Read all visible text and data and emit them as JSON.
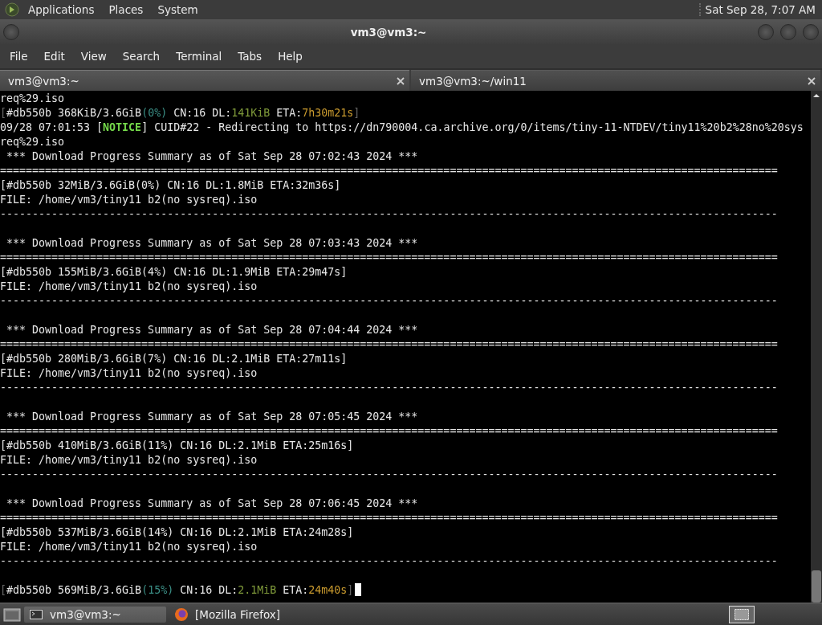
{
  "top_panel": {
    "menus": [
      "Applications",
      "Places",
      "System"
    ],
    "clock": "Sat Sep 28, 7:07 AM"
  },
  "window": {
    "title": "vm3@vm3:~"
  },
  "menu_bar": [
    "File",
    "Edit",
    "View",
    "Search",
    "Terminal",
    "Tabs",
    "Help"
  ],
  "tabs": [
    {
      "label": "vm3@vm3:~",
      "selected": true
    },
    {
      "label": "vm3@vm3:~/win11",
      "selected": false
    }
  ],
  "terminal": {
    "lines": [
      {
        "blank_before": false,
        "segments": [
          {
            "kind": "text",
            "text": "req%29.iso"
          }
        ]
      },
      {
        "blank_before": false,
        "segments": [
          {
            "kind": "dim",
            "text": "["
          },
          {
            "kind": "text",
            "text": "#db550b 368KiB/3.6GiB"
          },
          {
            "kind": "percent",
            "text": "(0%)"
          },
          {
            "kind": "text",
            "text": " CN:16 DL:"
          },
          {
            "kind": "speed",
            "text": "141KiB"
          },
          {
            "kind": "text",
            "text": " ETA:"
          },
          {
            "kind": "eta",
            "text": "7h30m21s"
          },
          {
            "kind": "dim",
            "text": "]"
          }
        ]
      },
      {
        "blank_before": false,
        "segments": [
          {
            "kind": "text",
            "text": "09/28 07:01:53 ["
          },
          {
            "kind": "notice",
            "text": "NOTICE"
          },
          {
            "kind": "text",
            "text": "] CUID#22 - Redirecting to https://dn790004.ca.archive.org/0/items/tiny-11-NTDEV/tiny11%20b2%28no%20sys"
          }
        ]
      },
      {
        "blank_before": false,
        "segments": [
          {
            "kind": "text",
            "text": "req%29.iso"
          }
        ]
      },
      {
        "blank_before": false,
        "segments": [
          {
            "kind": "text",
            "text": " *** Download Progress Summary as of Sat Sep 28 07:02:43 2024 ***"
          }
        ]
      },
      {
        "blank_before": false,
        "segments": [
          {
            "kind": "text",
            "text": "========================================================================================================================="
          }
        ]
      },
      {
        "blank_before": false,
        "segments": [
          {
            "kind": "text",
            "text": "[#db550b 32MiB/3.6GiB(0%) CN:16 DL:1.8MiB ETA:32m36s]"
          }
        ]
      },
      {
        "blank_before": false,
        "segments": [
          {
            "kind": "text",
            "text": "FILE: /home/vm3/tiny11 b2(no sysreq).iso"
          }
        ]
      },
      {
        "blank_before": false,
        "segments": [
          {
            "kind": "text",
            "text": "-------------------------------------------------------------------------------------------------------------------------"
          }
        ]
      },
      {
        "blank_before": true,
        "segments": [
          {
            "kind": "text",
            "text": " *** Download Progress Summary as of Sat Sep 28 07:03:43 2024 ***"
          }
        ]
      },
      {
        "blank_before": false,
        "segments": [
          {
            "kind": "text",
            "text": "========================================================================================================================="
          }
        ]
      },
      {
        "blank_before": false,
        "segments": [
          {
            "kind": "text",
            "text": "[#db550b 155MiB/3.6GiB(4%) CN:16 DL:1.9MiB ETA:29m47s]"
          }
        ]
      },
      {
        "blank_before": false,
        "segments": [
          {
            "kind": "text",
            "text": "FILE: /home/vm3/tiny11 b2(no sysreq).iso"
          }
        ]
      },
      {
        "blank_before": false,
        "segments": [
          {
            "kind": "text",
            "text": "-------------------------------------------------------------------------------------------------------------------------"
          }
        ]
      },
      {
        "blank_before": true,
        "segments": [
          {
            "kind": "text",
            "text": " *** Download Progress Summary as of Sat Sep 28 07:04:44 2024 ***"
          }
        ]
      },
      {
        "blank_before": false,
        "segments": [
          {
            "kind": "text",
            "text": "========================================================================================================================="
          }
        ]
      },
      {
        "blank_before": false,
        "segments": [
          {
            "kind": "text",
            "text": "[#db550b 280MiB/3.6GiB(7%) CN:16 DL:2.1MiB ETA:27m11s]"
          }
        ]
      },
      {
        "blank_before": false,
        "segments": [
          {
            "kind": "text",
            "text": "FILE: /home/vm3/tiny11 b2(no sysreq).iso"
          }
        ]
      },
      {
        "blank_before": false,
        "segments": [
          {
            "kind": "text",
            "text": "-------------------------------------------------------------------------------------------------------------------------"
          }
        ]
      },
      {
        "blank_before": true,
        "segments": [
          {
            "kind": "text",
            "text": " *** Download Progress Summary as of Sat Sep 28 07:05:45 2024 ***"
          }
        ]
      },
      {
        "blank_before": false,
        "segments": [
          {
            "kind": "text",
            "text": "========================================================================================================================="
          }
        ]
      },
      {
        "blank_before": false,
        "segments": [
          {
            "kind": "text",
            "text": "[#db550b 410MiB/3.6GiB(11%) CN:16 DL:2.1MiB ETA:25m16s]"
          }
        ]
      },
      {
        "blank_before": false,
        "segments": [
          {
            "kind": "text",
            "text": "FILE: /home/vm3/tiny11 b2(no sysreq).iso"
          }
        ]
      },
      {
        "blank_before": false,
        "segments": [
          {
            "kind": "text",
            "text": "-------------------------------------------------------------------------------------------------------------------------"
          }
        ]
      },
      {
        "blank_before": true,
        "segments": [
          {
            "kind": "text",
            "text": " *** Download Progress Summary as of Sat Sep 28 07:06:45 2024 ***"
          }
        ]
      },
      {
        "blank_before": false,
        "segments": [
          {
            "kind": "text",
            "text": "========================================================================================================================="
          }
        ]
      },
      {
        "blank_before": false,
        "segments": [
          {
            "kind": "text",
            "text": "[#db550b 537MiB/3.6GiB(14%) CN:16 DL:2.1MiB ETA:24m28s]"
          }
        ]
      },
      {
        "blank_before": false,
        "segments": [
          {
            "kind": "text",
            "text": "FILE: /home/vm3/tiny11 b2(no sysreq).iso"
          }
        ]
      },
      {
        "blank_before": false,
        "segments": [
          {
            "kind": "text",
            "text": "-------------------------------------------------------------------------------------------------------------------------"
          }
        ]
      },
      {
        "blank_before": true,
        "segments": [
          {
            "kind": "dim",
            "text": "["
          },
          {
            "kind": "text",
            "text": "#db550b 569MiB/3.6GiB"
          },
          {
            "kind": "percent",
            "text": "(15%)"
          },
          {
            "kind": "text",
            "text": " CN:16 DL:"
          },
          {
            "kind": "speed",
            "text": "2.1MiB"
          },
          {
            "kind": "text",
            "text": " ETA:"
          },
          {
            "kind": "eta",
            "text": "24m40s"
          },
          {
            "kind": "dim",
            "text": "]"
          }
        ]
      }
    ],
    "cursor": true
  },
  "taskbar": {
    "tasks": [
      {
        "label": "vm3@vm3:~",
        "kind": "terminal",
        "selected": true
      },
      {
        "label": "[Mozilla Firefox]",
        "kind": "browser",
        "selected": false
      }
    ]
  }
}
